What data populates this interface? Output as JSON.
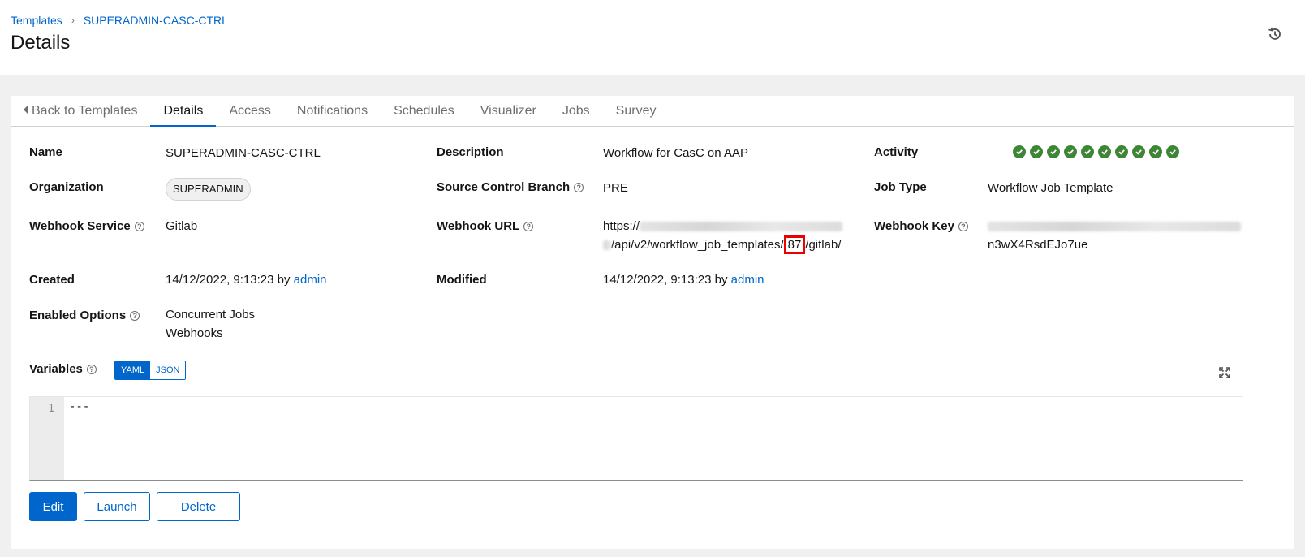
{
  "breadcrumb": {
    "root": "Templates",
    "current": "SUPERADMIN-CASC-CTRL"
  },
  "page": {
    "title": "Details"
  },
  "tabs": [
    "Back to Templates",
    "Details",
    "Access",
    "Notifications",
    "Schedules",
    "Visualizer",
    "Jobs",
    "Survey"
  ],
  "active_tab": "Details",
  "details": {
    "name": {
      "label": "Name",
      "value": "SUPERADMIN-CASC-CTRL"
    },
    "description": {
      "label": "Description",
      "value": "Workflow for CasC on AAP"
    },
    "activity": {
      "label": "Activity",
      "job_statuses": [
        "success",
        "success",
        "success",
        "success",
        "success",
        "success",
        "success",
        "success",
        "success",
        "success"
      ]
    },
    "organization": {
      "label": "Organization",
      "value": "SUPERADMIN"
    },
    "source_control_branch": {
      "label": "Source Control Branch",
      "value": "PRE"
    },
    "job_type": {
      "label": "Job Type",
      "value": "Workflow Job Template"
    },
    "webhook_service": {
      "label": "Webhook Service",
      "value": "Gitlab"
    },
    "webhook_url": {
      "label": "Webhook URL",
      "prefix": "https://",
      "path": "/api/v2/workflow_job_templates/",
      "id": "87",
      "suffix": "/gitlab/"
    },
    "webhook_key": {
      "label": "Webhook Key",
      "visible_tail": "n3wX4RsdEJo7ue"
    },
    "created": {
      "label": "Created",
      "date": "14/12/2022, 9:13:23",
      "by": "by",
      "user": "admin"
    },
    "modified": {
      "label": "Modified",
      "date": "14/12/2022, 9:13:23",
      "by": "by",
      "user": "admin"
    },
    "enabled_options": {
      "label": "Enabled Options",
      "values": [
        "Concurrent Jobs",
        "Webhooks"
      ]
    }
  },
  "variables": {
    "label": "Variables",
    "modes": [
      "YAML",
      "JSON"
    ],
    "selected_mode": "YAML",
    "line_number": "1",
    "content": "---"
  },
  "actions": {
    "edit": "Edit",
    "launch": "Launch",
    "delete": "Delete"
  },
  "colors": {
    "accent": "#0066cc",
    "success": "#3e8635",
    "highlight": "#ee0000"
  }
}
